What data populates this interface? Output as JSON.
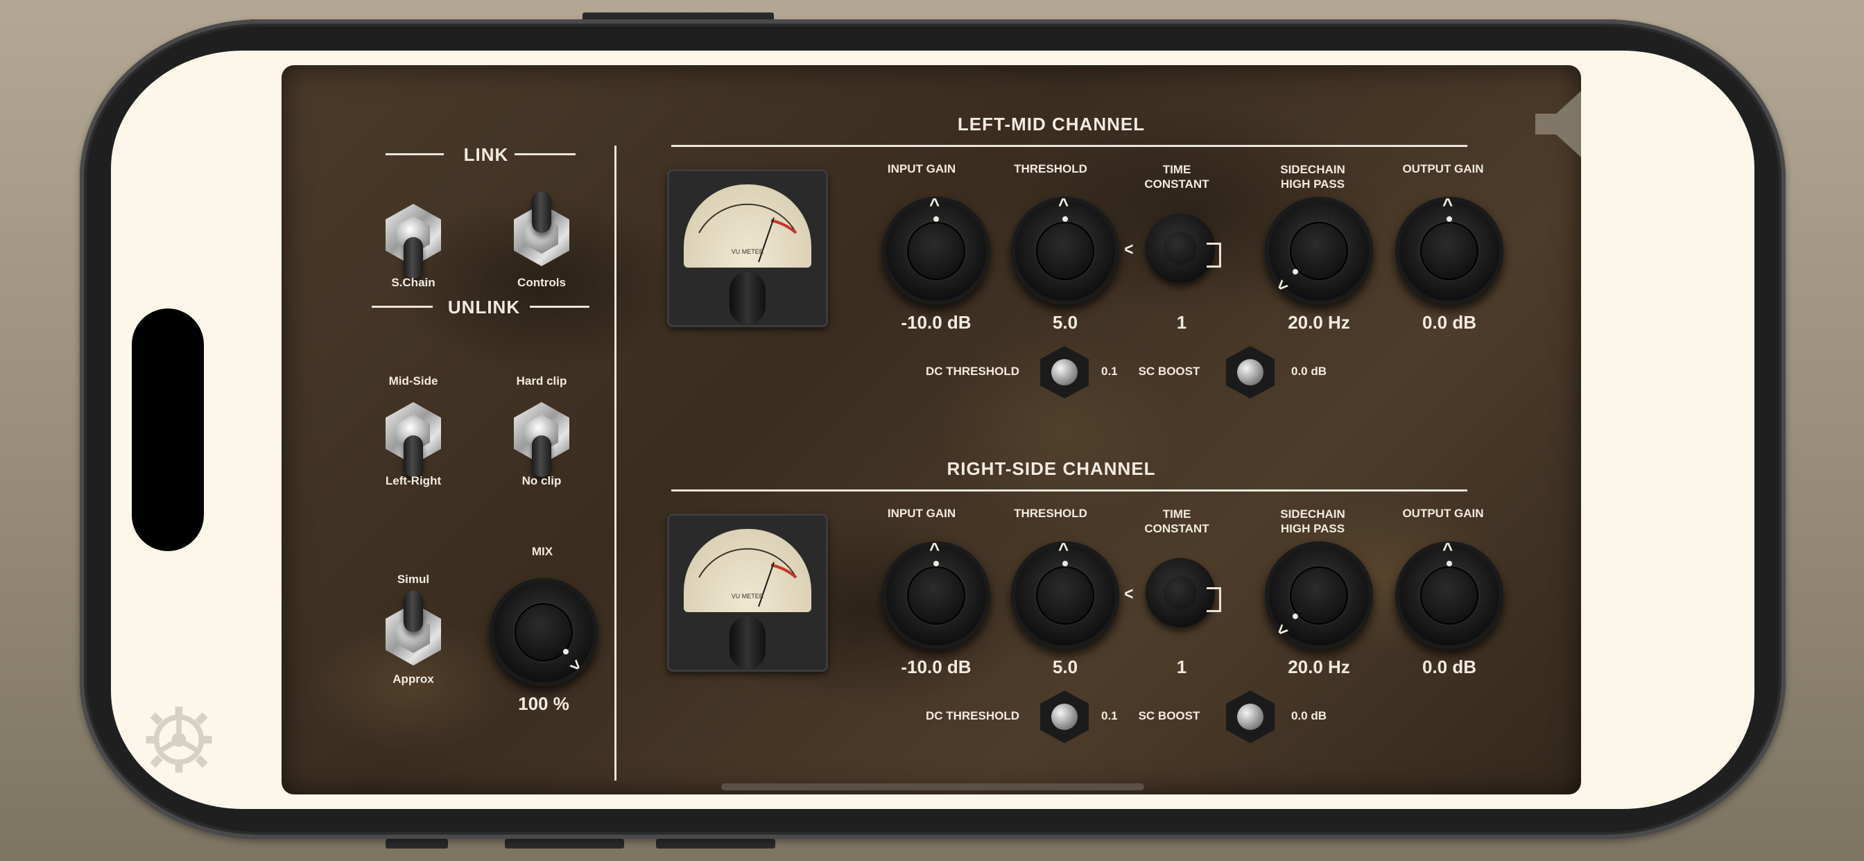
{
  "link": {
    "header": "LINK",
    "left_toggle_label": "S.Chain",
    "right_toggle_label": "Controls"
  },
  "unlink": {
    "header": "UNLINK",
    "mode_top": "Mid-Side",
    "mode_bottom": "Left-Right",
    "clip_top": "Hard clip",
    "clip_bottom": "No clip",
    "sim_top": "Simul",
    "sim_bottom": "Approx"
  },
  "mix": {
    "label": "MIX",
    "value": "100 %"
  },
  "channels": [
    {
      "title": "LEFT-MID CHANNEL",
      "knobs": [
        {
          "label": "INPUT GAIN",
          "value": "-10.0 dB"
        },
        {
          "label": "THRESHOLD",
          "value": "5.0"
        },
        {
          "label": "TIME CONSTANT",
          "value": "1"
        },
        {
          "label": "SIDECHAIN HIGH PASS",
          "value": "20.0 Hz"
        },
        {
          "label": "OUTPUT GAIN",
          "value": "0.0 dB"
        }
      ],
      "dc_threshold_label": "DC THRESHOLD",
      "dc_threshold_value": "0.1",
      "sc_boost_label": "SC BOOST",
      "sc_boost_value": "0.0 dB"
    },
    {
      "title": "RIGHT-SIDE CHANNEL",
      "knobs": [
        {
          "label": "INPUT GAIN",
          "value": "-10.0 dB"
        },
        {
          "label": "THRESHOLD",
          "value": "5.0"
        },
        {
          "label": "TIME CONSTANT",
          "value": "1"
        },
        {
          "label": "SIDECHAIN HIGH PASS",
          "value": "20.0 Hz"
        },
        {
          "label": "OUTPUT GAIN",
          "value": "0.0 dB"
        }
      ],
      "dc_threshold_label": "DC THRESHOLD",
      "dc_threshold_value": "0.1",
      "sc_boost_label": "SC BOOST",
      "sc_boost_value": "0.0 dB"
    }
  ],
  "vu": {
    "brand_text": "VU METER"
  },
  "icons": {
    "settings": "gear-icon",
    "speaker": "speaker-icon"
  },
  "colors": {
    "panel": "#3e3023",
    "text": "#f2ece0",
    "screen_bg": "#fdf7ea"
  }
}
